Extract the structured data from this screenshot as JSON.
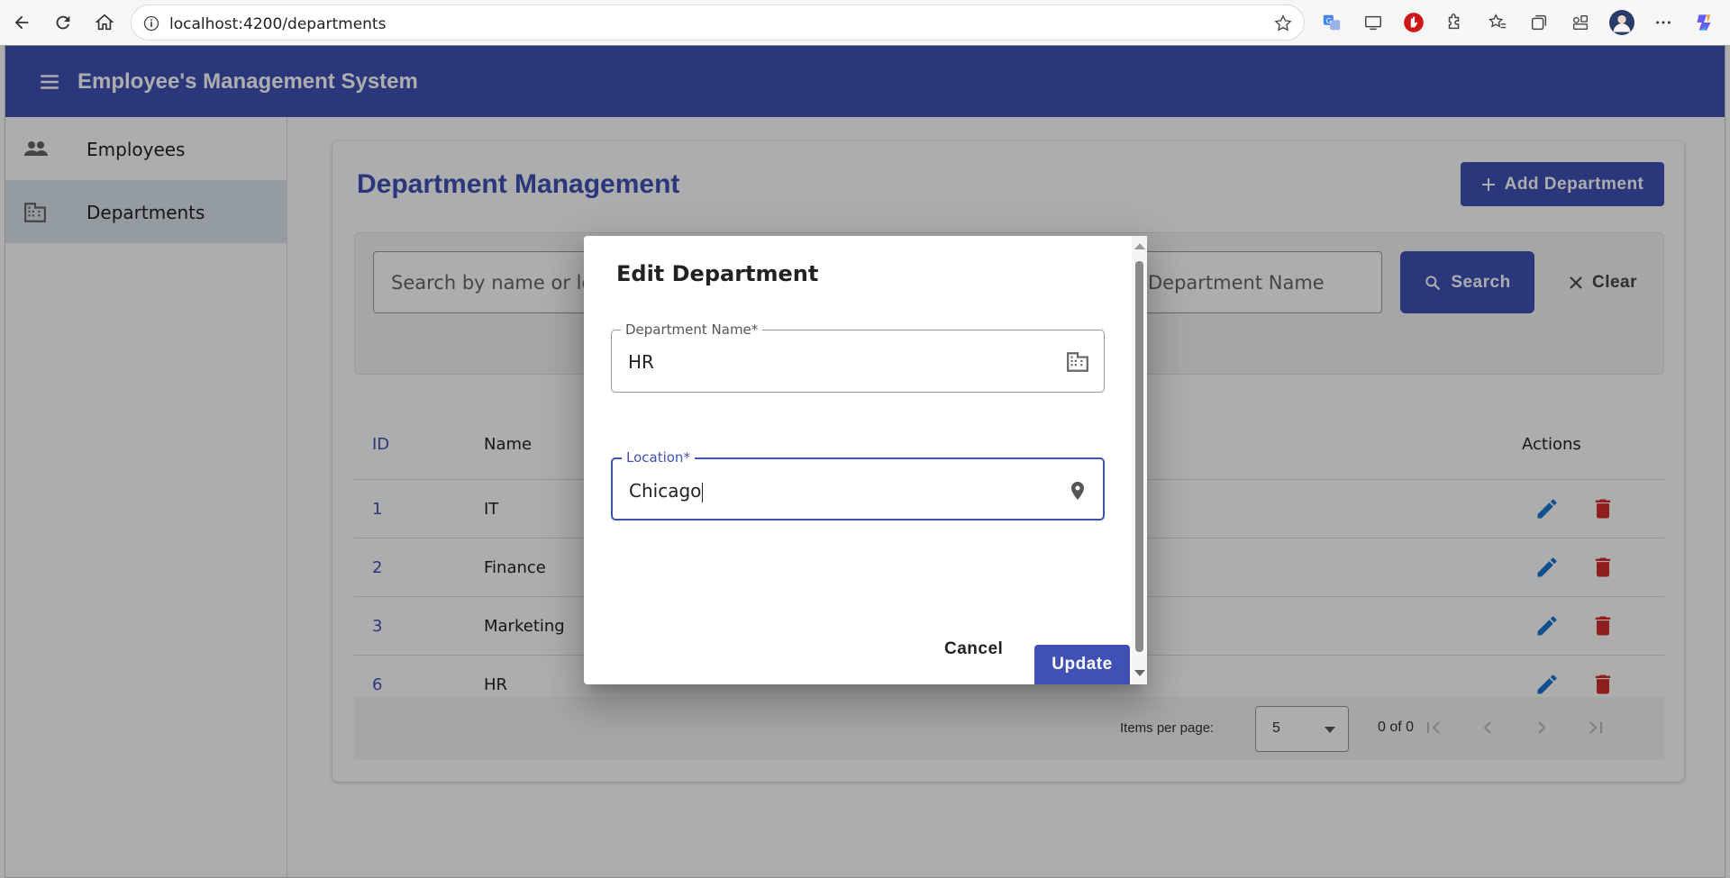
{
  "browser": {
    "url": "localhost:4200/departments"
  },
  "app": {
    "title": "Employee's Management System"
  },
  "sidebar": {
    "items": [
      {
        "label": "Employees",
        "icon": "people-icon",
        "active": false
      },
      {
        "label": "Departments",
        "icon": "building-icon",
        "active": true
      }
    ]
  },
  "page": {
    "title": "Department Management",
    "add_button": "Add Department",
    "search": {
      "placeholder": "Search by name or location",
      "name_placeholder": "Department Name",
      "search_button": "Search",
      "clear_button": "Clear"
    }
  },
  "table": {
    "columns": [
      "ID",
      "Name",
      "Actions"
    ],
    "rows": [
      {
        "id": "1",
        "name": "IT"
      },
      {
        "id": "2",
        "name": "Finance"
      },
      {
        "id": "3",
        "name": "Marketing"
      },
      {
        "id": "6",
        "name": "HR"
      }
    ]
  },
  "paginator": {
    "items_per_page_label": "Items per page:",
    "page_size": "5",
    "range_label": "0 of 0"
  },
  "dialog": {
    "title": "Edit Department",
    "name_field": {
      "label": "Department Name*",
      "value": "HR"
    },
    "location_field": {
      "label": "Location*",
      "value": "Chicago"
    },
    "cancel_label": "Cancel",
    "update_label": "Update"
  },
  "colors": {
    "primary": "#3f51b5",
    "edit": "#1976d2",
    "delete": "#d32f2f"
  }
}
